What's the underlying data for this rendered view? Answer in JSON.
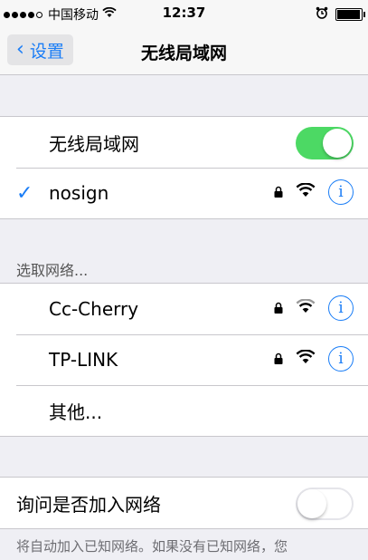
{
  "status_bar": {
    "carrier": "中国移动",
    "time": "12:37"
  },
  "nav": {
    "back_label": "设置",
    "title": "无线局域网"
  },
  "wifi_toggle": {
    "label": "无线局域网",
    "on": true
  },
  "connected": {
    "name": "nosign"
  },
  "choose_header": "选取网络...",
  "networks": [
    {
      "name": "Cc-Cherry"
    },
    {
      "name": "TP-LINK"
    }
  ],
  "other_label": "其他...",
  "ask_join": {
    "label": "询问是否加入网络",
    "on": false
  },
  "footer": "将自动加入已知网络。如果没有已知网络，您"
}
